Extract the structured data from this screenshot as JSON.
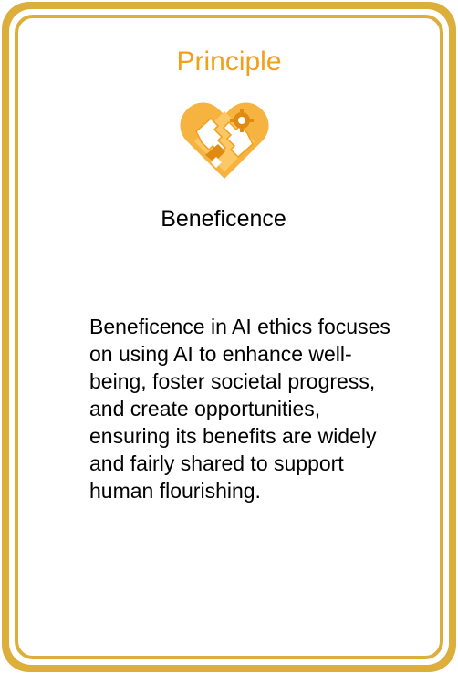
{
  "card": {
    "category": "Principle",
    "title": "Beneficence",
    "description": "Beneficence in AI ethics focuses on using AI to enhance well-being, foster societal progress, and create opportunities, ensuring its benefits are widely and fairly shared to support human flourishing.",
    "icon": "heart-hands-gear-icon"
  },
  "colors": {
    "border": "#dcae3c",
    "accent": "#f0a01c",
    "text": "#000000",
    "background": "#ffffff"
  }
}
